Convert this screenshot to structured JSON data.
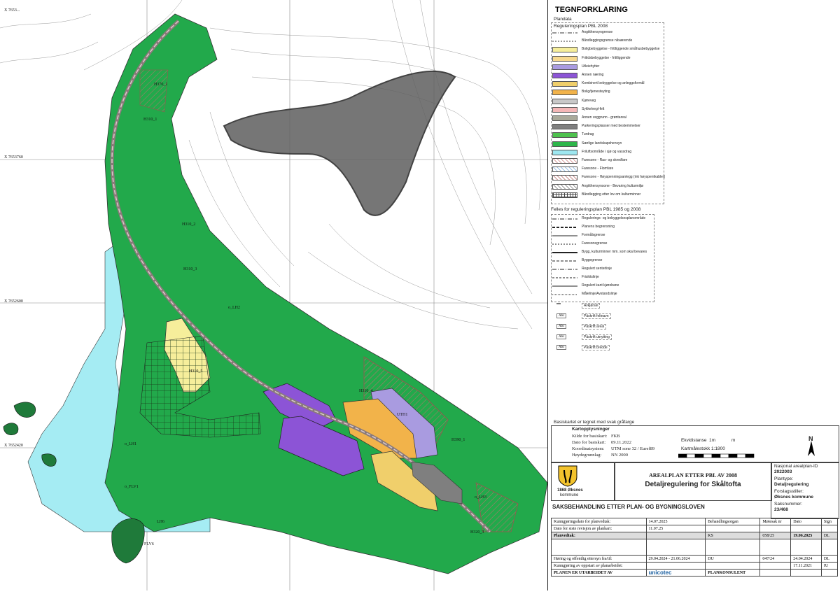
{
  "map": {
    "coords": {
      "top_left": "X 7653...",
      "y1": "X 7653760",
      "y2": "X 7652600",
      "y3": "X 7652420"
    },
    "zones": [
      {
        "id": "h370_1",
        "text": "H370_1"
      },
      {
        "id": "h310_1",
        "text": "H310_1"
      },
      {
        "id": "h310_2",
        "text": "H310_2"
      },
      {
        "id": "h310_3",
        "text": "H310_3"
      },
      {
        "id": "lh2",
        "text": "o_LH2"
      },
      {
        "id": "h310_4",
        "text": "H310_4"
      },
      {
        "id": "uth",
        "text": "UTH1"
      },
      {
        "id": "h390_1",
        "text": "H390_1"
      },
      {
        "id": "lh1",
        "text": "o_LH1"
      },
      {
        "id": "flv1",
        "text": "o_FLV1"
      },
      {
        "id": "lh6",
        "text": "LH6"
      },
      {
        "id": "flv6",
        "text": "FLV6"
      },
      {
        "id": "h320_3",
        "text": "H320_3"
      },
      {
        "id": "lh3",
        "text": "o_LH3"
      },
      {
        "id": "h310_5",
        "text": "H310_5"
      }
    ]
  },
  "legend": {
    "title": "TEGNFORKLARING",
    "plandata": "Plandata",
    "reg_plan": "Reguleringsplan   PBL 2008",
    "rows": [
      {
        "label": "Angitthensyngrense",
        "kind": "line",
        "color": "#333",
        "dash": "6,2,1,2"
      },
      {
        "label": "Båndleggingsgrense nåværende",
        "kind": "line",
        "color": "#333",
        "dash": "2,2"
      },
      {
        "label": "Boligbebyggelse - frittliggende småhusbebyggelse",
        "kind": "fill",
        "color": "#f6ee9b"
      },
      {
        "label": "Fritidsbebyggelse - frittliggende",
        "kind": "fill",
        "color": "#f7d98f"
      },
      {
        "label": "Utleiehytter",
        "kind": "fill",
        "color": "#a99be0"
      },
      {
        "label": "Annen næring",
        "kind": "fill",
        "color": "#8c54d6"
      },
      {
        "label": "Kombinert bebyggelse og anleggsformål",
        "kind": "fill",
        "color": "#f0cf6b"
      },
      {
        "label": "Bolig/tjenesteyting",
        "kind": "fill",
        "color": "#f2b34a"
      },
      {
        "label": "Kjøreveg",
        "kind": "fill",
        "color": "#c8c8c8"
      },
      {
        "label": "Sykkelvegl-felt",
        "kind": "fill",
        "color": "#f4b7b7"
      },
      {
        "label": "Annen veggrunn - grøntareal",
        "kind": "fill",
        "color": "#a9a99a"
      },
      {
        "label": "Parkeringsplasser med bestemmelser",
        "kind": "fill",
        "color": "#7f7f7f"
      },
      {
        "label": "Turdrag",
        "kind": "fill",
        "color": "#4ec24e"
      },
      {
        "label": "Særlige landskapshensyn",
        "kind": "fill",
        "color": "#2db64a"
      },
      {
        "label": "Friluftsområde i sjø og vassdrag",
        "kind": "fill",
        "color": "#9ee7f0"
      },
      {
        "label": "Faresone - Ras- og skredfare",
        "kind": "hatch",
        "color": "#d9a0a0"
      },
      {
        "label": "Faresone - Flomfare",
        "kind": "hatch",
        "color": "#9fc2e6"
      },
      {
        "label": "Faresone - Høyspenningsanlegg (ink høyspentkabler)",
        "kind": "hatch",
        "color": "#c89090"
      },
      {
        "label": "Angitthensynsone - Bevaring kulturmiljø",
        "kind": "hatch",
        "color": "#999999"
      },
      {
        "label": "Båndlegging etter lov om kulturminner",
        "kind": "grid",
        "color": "#444"
      }
    ],
    "felles": "Felles for reguleringsplan PBL 1985 og 2008",
    "line_rows": [
      {
        "label": "Regulerings- og bebyggelsesplanområde",
        "dash": "6,2,1,2",
        "w": 1
      },
      {
        "label": "Planens begrensning",
        "dash": "4,2",
        "w": 2
      },
      {
        "label": "Formålsgrense",
        "dash": "",
        "w": 1
      },
      {
        "label": "Faresonegrense",
        "dash": "2,2",
        "w": 1
      },
      {
        "label": "Bygg, kulturminner mm. som skal bevares",
        "dash": "",
        "w": 2
      },
      {
        "label": "Byggegrense",
        "dash": "4,2",
        "w": 1
      },
      {
        "label": "Regulert senterlinje",
        "dash": "6,2,1,2",
        "w": 1
      },
      {
        "label": "Frisiktslinje",
        "dash": "3,2",
        "w": 1
      },
      {
        "label": "Regulert kant kjørebane",
        "dash": "",
        "w": 1
      },
      {
        "label": "Målelinje/Avstandslinje",
        "dash": "1,1",
        "w": 1
      }
    ],
    "symbol_rows": [
      {
        "sym": "",
        "label": "Avkjørsel"
      },
      {
        "sym": "Abc",
        "label": "Påskrift feltnavn"
      },
      {
        "sym": "Abc",
        "label": "Påskrift areal"
      },
      {
        "sym": "Abc",
        "label": "Påskrift utnytting"
      },
      {
        "sym": "Abc",
        "label": "Påskrift bredde"
      }
    ],
    "basis_note": "Basiskartet er tegnet med svak gråfarge"
  },
  "kart": {
    "title": "Kartopplysninger",
    "rows": [
      {
        "k": "Kilde for basiskart:",
        "v": "FKB"
      },
      {
        "k": "Dato for basiskart:",
        "v": "09.11.2022"
      },
      {
        "k": "Koordinatsystem:",
        "v": "UTM sone 32 / Euref89"
      },
      {
        "k": "Høydegrunnlag:",
        "v": "NN 2000"
      }
    ],
    "ekvidistanse_label": "Ekvidistanse",
    "ekvidistanse_val": "1m",
    "ekvidistanse_unit": "m",
    "scale": "Kartmålestokk 1:1800",
    "scale_ticks": [
      "0",
      "10",
      "20",
      "30",
      "40",
      "50",
      "60",
      "70",
      "80",
      "90"
    ],
    "north": "N"
  },
  "title_block": {
    "kommune": "1868 Øksnes",
    "kommune2": "kommune",
    "act": "AREALPLAN ETTER PBL AV 2008",
    "plan_name": "Detaljregulering for Skåltofta",
    "nasjonal_label": "Nasjonal arealplan-ID",
    "nasjonal_id": "2022003",
    "plantype_label": "Plantype:",
    "plantype": "Detaljregulering",
    "forslag_label": "Forslagsstiller:",
    "forslag": "Øksnes kommune",
    "saksnr_label": "Saksnummer:",
    "saksnr": "23/468"
  },
  "saks": {
    "heading": "SAKSBEHANDLING ETTER PLAN- OG BYGNINGSLOVEN",
    "kunngjoring_label": "Kunngjøringsdato for planvedtak:",
    "kunngjoring": "14.07.2025",
    "revisjon_label": "Dato for siste revisjon av plankart:",
    "revisjon": "11.07.25",
    "cols": [
      "Behandlingsorgan",
      "Møtesak nr",
      "Dato",
      "Sign"
    ],
    "planvedtak": {
      "label": "Planvedtak:",
      "org": "KS",
      "sak": "058/25",
      "dato": "19.06.2025",
      "sign": "DL"
    },
    "horing": {
      "label": "Høring og offentlig ettersyn fra/til:",
      "period": "29.04.2024 - 21.06.2024",
      "org": "DU",
      "sak": "047/24",
      "dato": "24.04.2024",
      "sign": "DL"
    },
    "oppstart": {
      "label": "Kunngjøring av oppstart av planarbeidet:",
      "dato": "17.11.2021",
      "sign": "IU"
    },
    "utarbeidet": "PLANEN ER UTARBEIDET AV",
    "company1": "unicotec",
    "company2": "PLANKONSULENT"
  },
  "colors": {
    "green": "#22a94b",
    "cyan": "#a5ecf3",
    "yellow": "#f6ee9b",
    "purple": "#8c54d6",
    "orange": "#f2b34a",
    "road": "#8a7a7a"
  }
}
